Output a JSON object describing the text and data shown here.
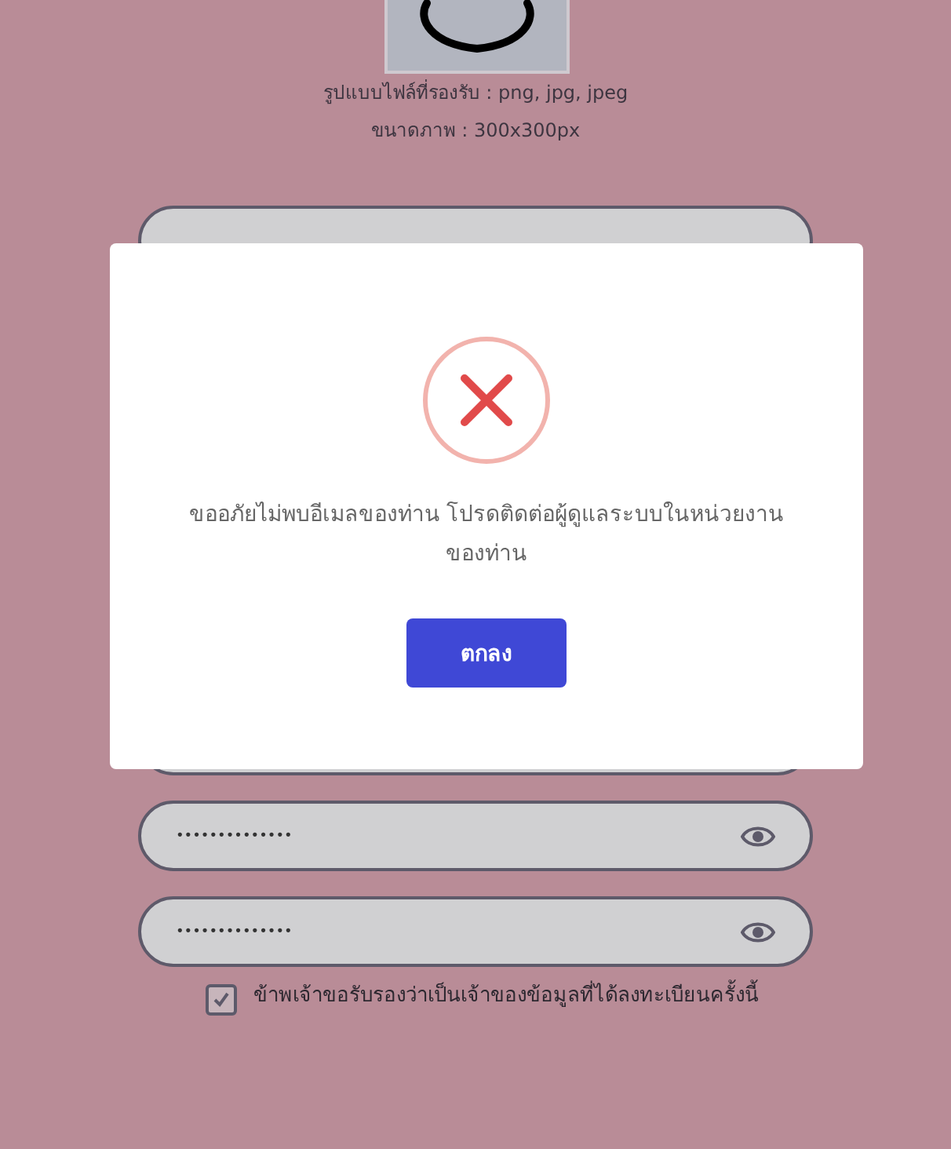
{
  "upload_hint": {
    "formats": "รูปแบบไฟล์ที่รองรับ : png, jpg, jpeg",
    "size": "ขนาดภาพ : 300x300px"
  },
  "password_fields": [
    {
      "value": "••••••••••••••"
    },
    {
      "value": "••••••••••••••"
    }
  ],
  "consent": {
    "label": "ข้าพเจ้าขอรับรองว่าเป็นเจ้าของข้อมูลที่ได้ลงทะเบียนครั้งนี้",
    "checked": true
  },
  "dialog": {
    "message": "ขออภัยไม่พบอีเมลของท่าน โปรดติดต่อผู้ดูแลระบบในหน่วยงานของท่าน",
    "button": "ตกลง"
  }
}
